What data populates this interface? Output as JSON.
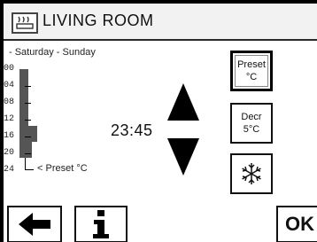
{
  "header": {
    "title": "LIVING ROOM",
    "icon": "radiator-icon"
  },
  "schedule": {
    "days_label": "- Saturday - Sunday",
    "hour_labels": [
      "00",
      "04",
      "08",
      "12",
      "16",
      "20",
      "24"
    ],
    "preset_note": "< Preset °C"
  },
  "clock": {
    "time": "23:45"
  },
  "controls": {
    "up_icon": "arrow-up-icon",
    "down_icon": "arrow-down-icon"
  },
  "side_buttons": {
    "preset": {
      "line1": "Preset",
      "line2": "°C"
    },
    "decrease": {
      "line1": "Decr",
      "line2": "5°C"
    },
    "frost": {
      "icon": "snowflake-icon"
    }
  },
  "footer": {
    "back_icon": "arrow-left-icon",
    "info_icon": "info-icon",
    "ok_label": "OK"
  }
}
